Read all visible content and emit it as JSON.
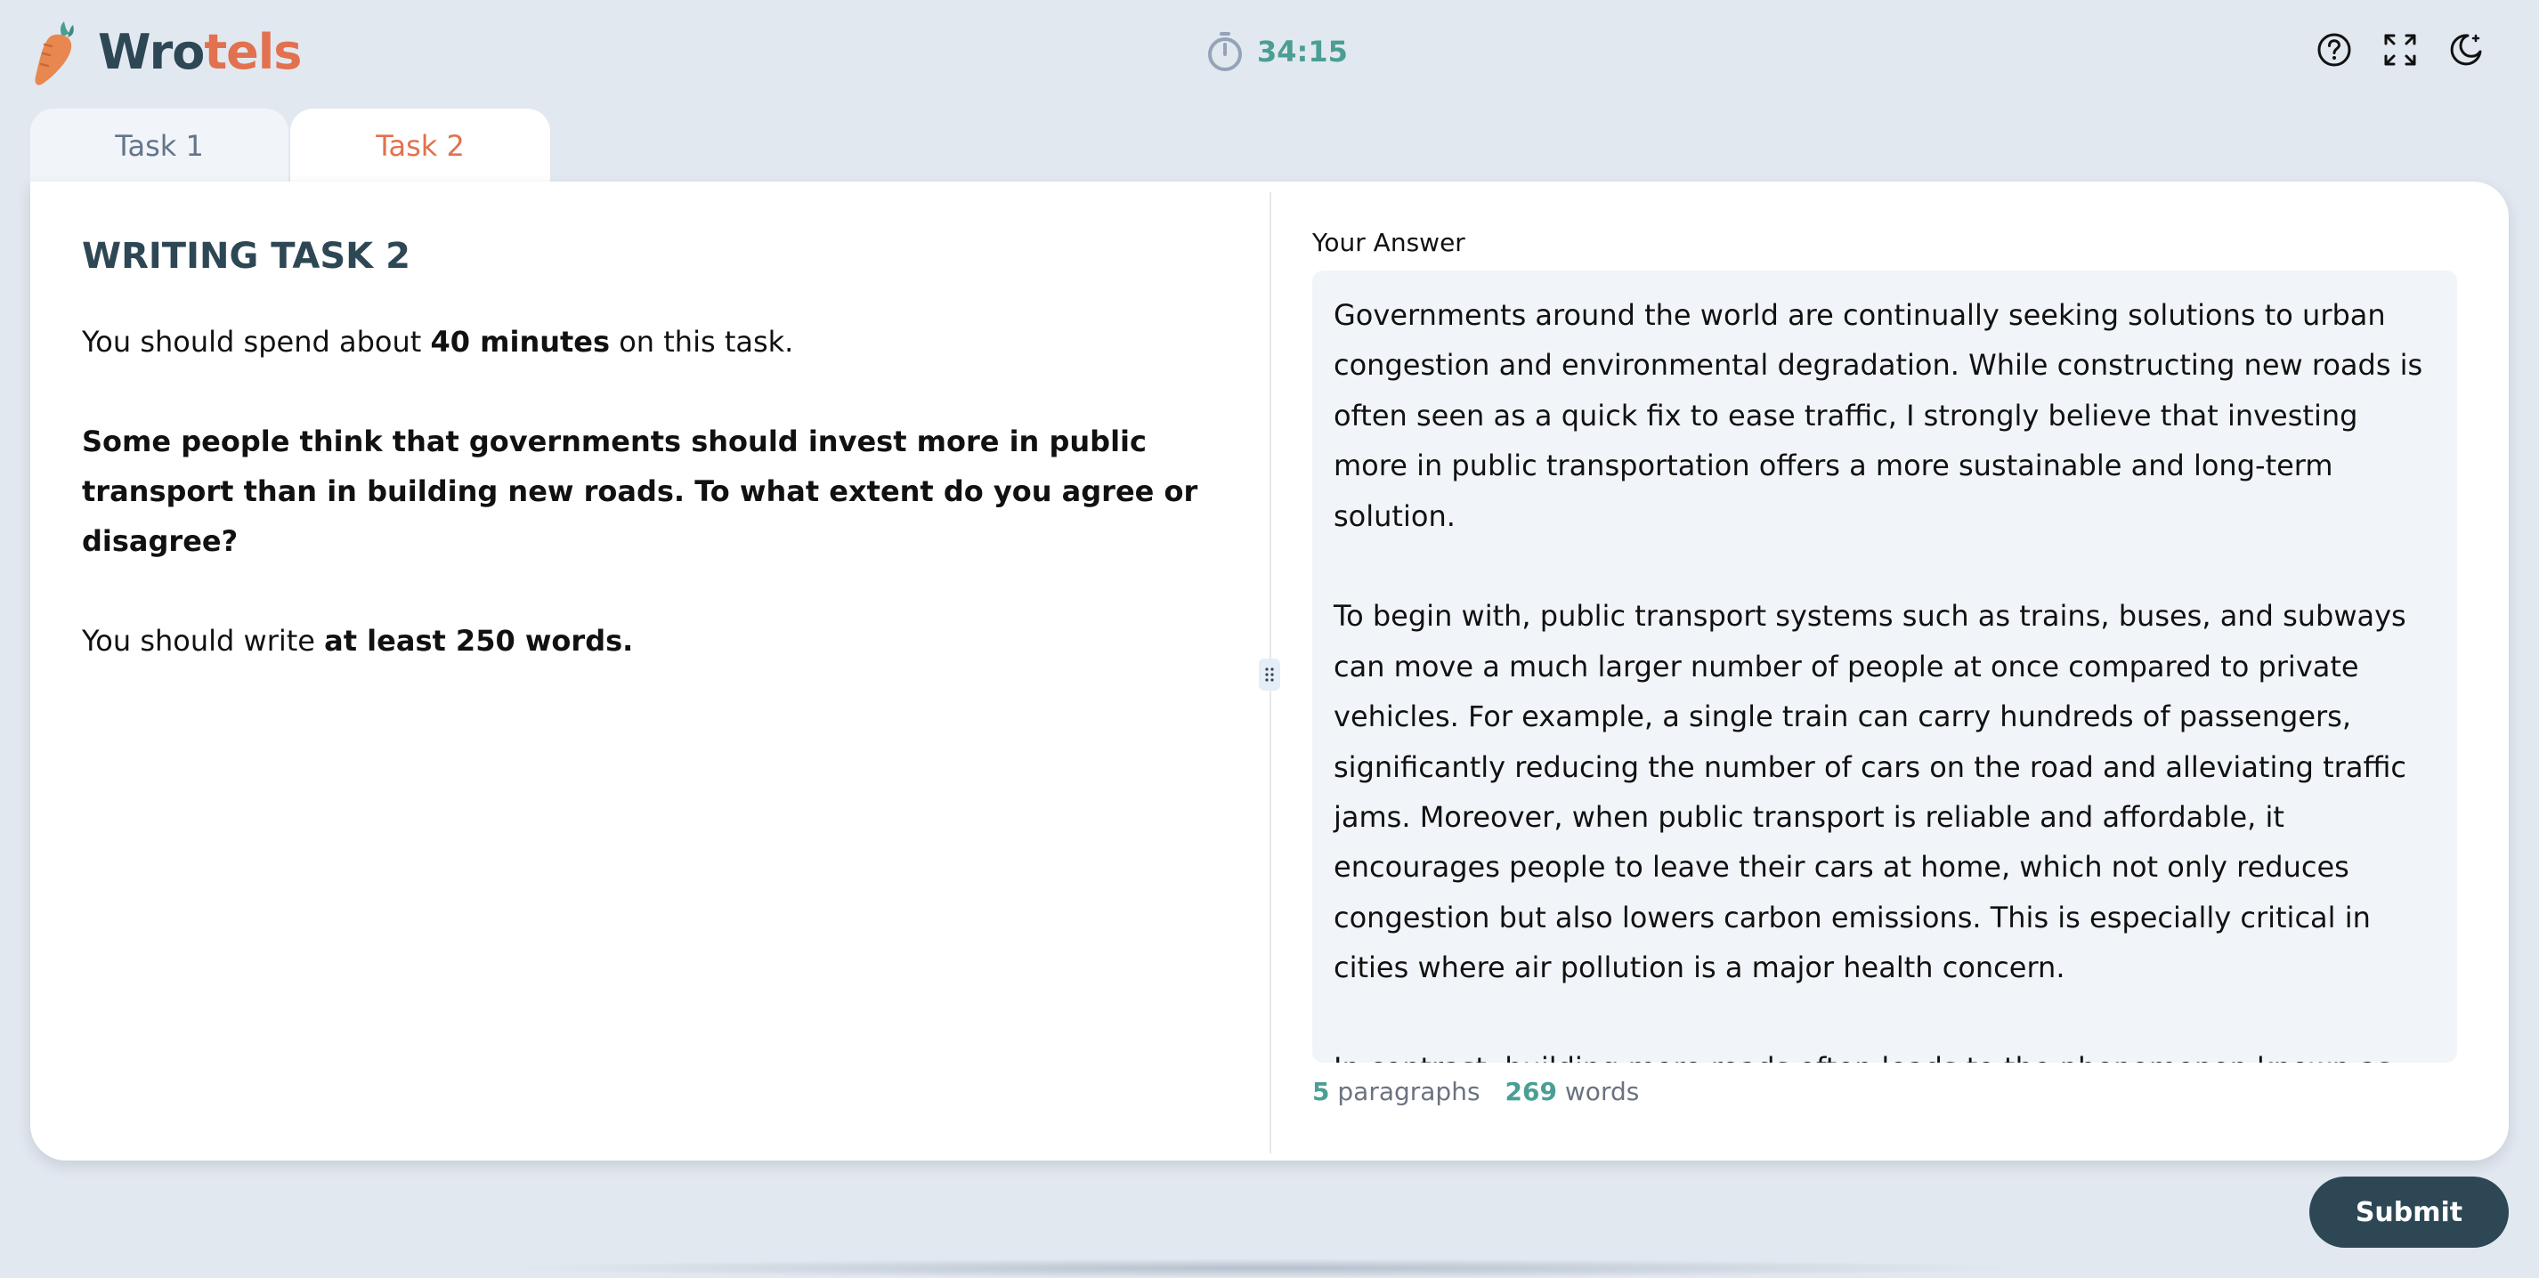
{
  "brand": {
    "logo_part1": "Wro",
    "logo_part2": "tels",
    "logo_icon": "carrot-icon",
    "primary_color": "#2d4754",
    "accent_color": "#e2714f",
    "success_color": "#4b9e94"
  },
  "header": {
    "timer": "34:15",
    "icons": [
      "stopwatch-icon",
      "help-icon",
      "fullscreen-icon",
      "dark-mode-icon"
    ]
  },
  "tabs": [
    {
      "label": "Task 1",
      "active": false
    },
    {
      "label": "Task 2",
      "active": true
    }
  ],
  "question": {
    "title": "WRITING TASK 2",
    "time_pre": "You should spend about ",
    "time_bold": "40 minutes",
    "time_post": " on this task.",
    "prompt": "Some people think that governments should invest more in public transport than in building new roads. To what extent do you agree or disagree?",
    "words_pre": "You should write ",
    "words_bold": "at least 250 words."
  },
  "answer": {
    "label": "Your Answer",
    "paragraphs": [
      "Governments around the world are continually seeking solutions to urban congestion and environmental degradation. While constructing new roads is often seen as a quick fix to ease traffic, I strongly believe that investing more in public transportation offers a more sustainable and long-term solution.",
      "To begin with, public transport systems such as trains, buses, and subways can move a much larger number of people at once compared to private vehicles. For example, a single train can carry hundreds of passengers, significantly reducing the number of cars on the road and alleviating traffic jams. Moreover, when public transport is reliable and affordable, it encourages people to leave their cars at home, which not only reduces congestion but also lowers carbon emissions. This is especially critical in cities where air pollution is a major health concern.",
      "In contrast, building more roads often leads to the phenomenon known as \"induced demand,\" where increasing road capacity encourages more people to drive, ultimately resulting in even worse traffic. Additionally, road construction"
    ]
  },
  "counts": {
    "paragraphs_value": "5",
    "paragraphs_label": "paragraphs",
    "words_value": "269",
    "words_label": "words"
  },
  "actions": {
    "submit_label": "Submit"
  }
}
